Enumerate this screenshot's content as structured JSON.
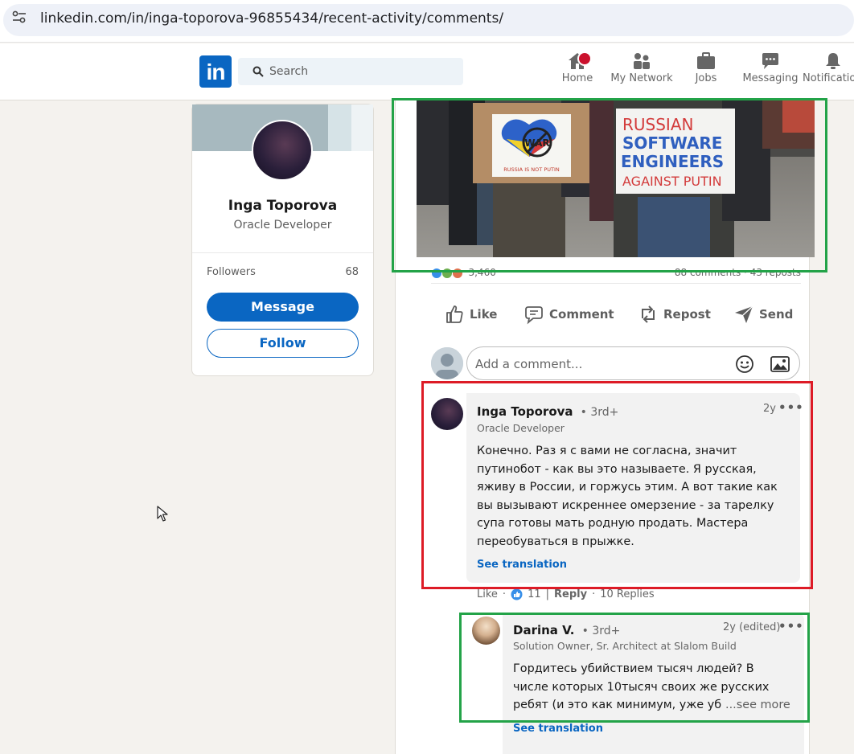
{
  "browser": {
    "url": "linkedin.com/in/inga-toporova-96855434/recent-activity/comments/"
  },
  "nav": {
    "logo": "in",
    "search_placeholder": "Search",
    "items": [
      {
        "label": "Home",
        "icon": "home-icon"
      },
      {
        "label": "My Network",
        "icon": "network-icon"
      },
      {
        "label": "Jobs",
        "icon": "briefcase-icon"
      },
      {
        "label": "Messaging",
        "icon": "messaging-icon"
      },
      {
        "label": "Notifications",
        "icon": "bell-icon"
      }
    ],
    "notification_badge_color": "#cb112d"
  },
  "profile": {
    "name": "Inga Toporova",
    "title": "Oracle Developer",
    "followers_label": "Followers",
    "followers_count": "68",
    "message_label": "Message",
    "follow_label": "Follow"
  },
  "post": {
    "sign_left_line1": "WAR",
    "sign_left_line2": "RUSSIA IS NOT PUTIN",
    "sign_right": [
      "RUSSIAN",
      "SOFTWARE",
      "ENGINEERS",
      "AGAINST PUTIN"
    ],
    "reaction_count": "3,460",
    "comments_count": "88 comments",
    "reposts_count": "43 reposts",
    "actions": {
      "like": "Like",
      "comment": "Comment",
      "repost": "Repost",
      "send": "Send"
    },
    "comment_placeholder": "Add a comment..."
  },
  "comments": [
    {
      "author": "Inga Toporova",
      "degree": "• 3rd+",
      "headline": "Oracle Developer",
      "time": "2y",
      "body": "Конечно. Раз я с вами не согласна, значит путинобот - как вы это называете. Я русская, яживу в России, и горжусь этим. А вот такие как вы вызывают искреннее омерзение - за тарелку супа готовы мать родную продать. Мастера переобуваться в прыжке.",
      "see_translation": "See translation",
      "like_label": "Like",
      "reaction_count": "11",
      "reply_label": "Reply",
      "replies_label": "10 Replies"
    },
    {
      "author": "Darina V.",
      "degree": "• 3rd+",
      "headline": "Solution Owner, Sr. Architect at Slalom Build",
      "time": "2y (edited)",
      "body": "Гордитесь убийствием тысяч людей? В числе которых 10тысяч своих же русских ребят (и это как минимум, уже убитых)... или",
      "see_more": "...see more",
      "see_translation": "See translation"
    }
  ],
  "annotations": {
    "green": "#23a348",
    "red": "#dd1b26"
  }
}
